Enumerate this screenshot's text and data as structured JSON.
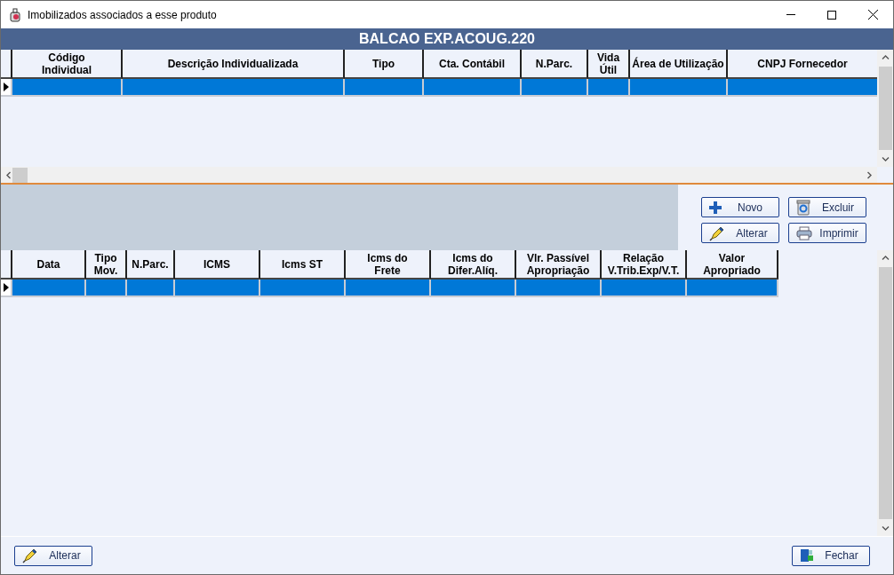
{
  "window": {
    "title": "Imobilizados associados a esse produto"
  },
  "product_title": "BALCAO EXP.ACOUG.220",
  "items_grid": {
    "columns": [
      "Código Individual",
      "Descrição Individualizada",
      "Tipo",
      "Cta. Contábil",
      "N.Parc.",
      "Vida Útil",
      "Área de Utilização",
      "CNPJ Fornecedor"
    ],
    "rows": [
      {
        "selected": true
      }
    ]
  },
  "actions": [
    {
      "label": "Novo",
      "kind": "plus"
    },
    {
      "label": "Excluir",
      "kind": "bin"
    },
    {
      "label": "Alterar",
      "kind": "pencil"
    },
    {
      "label": "Imprimir",
      "kind": "printer"
    }
  ],
  "installments_grid": {
    "columns": [
      "Data",
      "Tipo Mov.",
      "N.Parc.",
      "ICMS",
      "Icms ST",
      "Icms do Frete",
      "Icms do Difer.Alíq.",
      "Vlr. Passível Apropriação",
      "Relação V.Trib.Exp/V.T.",
      "Valor Apropriado"
    ],
    "rows": [
      {
        "selected": true
      }
    ]
  },
  "footer": [
    {
      "label": "Alterar",
      "kind": "pencil"
    },
    {
      "label": "Fechar",
      "kind": "door"
    }
  ]
}
